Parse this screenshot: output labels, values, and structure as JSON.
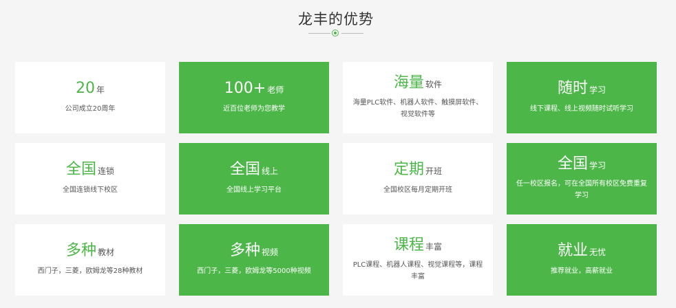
{
  "section": {
    "title": "龙丰的优势"
  },
  "colors": {
    "accent": "#4cb648",
    "white_card": "#ffffff",
    "background": "#f5f5f5"
  },
  "cards": [
    {
      "big": "20",
      "small": "年",
      "desc": "公司成立20周年",
      "style": "white"
    },
    {
      "big": "100+",
      "small": "老师",
      "desc": "近百位老师为您教学",
      "style": "green"
    },
    {
      "big": "海量",
      "small": "软件",
      "desc": "海量PLC软件、机器人软件、触摸屏软件、视觉软件等",
      "style": "white"
    },
    {
      "big": "随时",
      "small": "学习",
      "desc": "线下课程、线上视频随时试听学习",
      "style": "green"
    },
    {
      "big": "全国",
      "small": "连锁",
      "desc": "全国连锁线下校区",
      "style": "white"
    },
    {
      "big": "全国",
      "small": "线上",
      "desc": "全国线上学习平台",
      "style": "green"
    },
    {
      "big": "定期",
      "small": "开班",
      "desc": "全国校区每月定期开班",
      "style": "white"
    },
    {
      "big": "全国",
      "small": "学习",
      "desc": "任一校区报名，可在全国所有校区免费重复学习",
      "style": "green"
    },
    {
      "big": "多种",
      "small": "教材",
      "desc": "西门子，三菱，欧姆龙等28种教材",
      "style": "white"
    },
    {
      "big": "多种",
      "small": "视频",
      "desc": "西门子，三菱，欧姆龙等5000种视频",
      "style": "green"
    },
    {
      "big": "课程",
      "small": "丰富",
      "desc": "PLC课程、机器人课程、视觉课程等，课程丰富",
      "style": "white"
    },
    {
      "big": "就业",
      "small": "无忧",
      "desc": "推荐就业，高薪就业",
      "style": "green"
    }
  ]
}
